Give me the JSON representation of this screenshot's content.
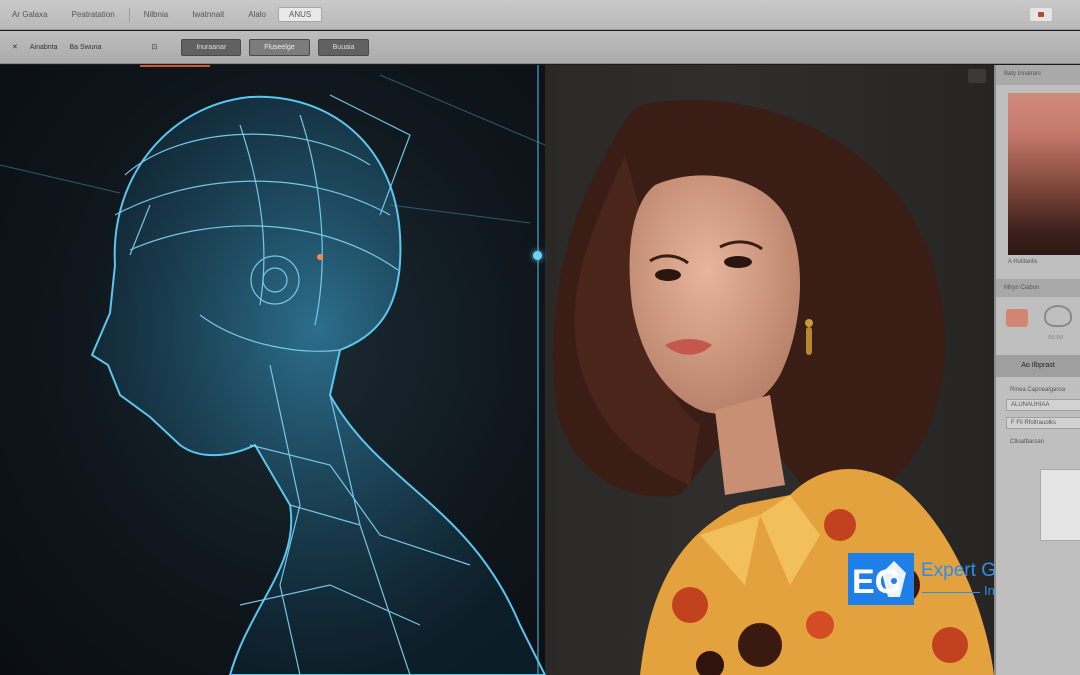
{
  "menubar": {
    "items": [
      "Ar Galaxa",
      "Peatratation",
      "Nilbnia",
      "Iwatnnait",
      "Alalo",
      "ANUS"
    ],
    "active_index": 5
  },
  "toolbar": {
    "items": [
      "Ainabnta",
      "Ba Swuna"
    ],
    "buttons": [
      "Inuraanar",
      "Fluseelge",
      "Buuaia"
    ]
  },
  "panel": {
    "header": "Baty Innalrars",
    "swatch_caption": "A Hulitanlis",
    "section": "Mhyn Ciabon",
    "title": "Ao Ilbprast",
    "rows": [
      "Rinea Capnealgaroa",
      "ALUNAUHIAA",
      "F Fll Rfoltrauolks",
      "Ctloatbarsan"
    ],
    "colors": {
      "swatch_top": "#d08a7c",
      "swatch_bottom": "#2b1713"
    }
  },
  "watermark": {
    "line1": "Expert Graphic",
    "line2": "International",
    "color": "#1e7fe8"
  },
  "colors": {
    "accent": "#4fb3d8",
    "wireframe": "#5cc6ee"
  }
}
